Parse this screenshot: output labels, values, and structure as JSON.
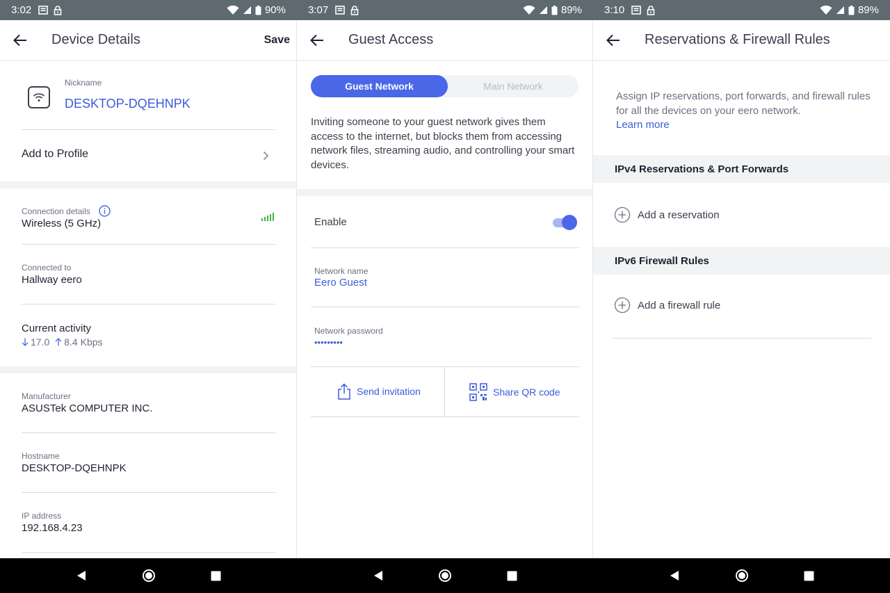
{
  "screens": [
    {
      "status": {
        "time": "3:02",
        "battery": "90%"
      },
      "header": {
        "title": "Device Details",
        "save_label": "Save"
      },
      "nickname": {
        "label": "Nickname",
        "value": "DESKTOP-DQEHNPK",
        "icon": "wifi-icon"
      },
      "add_to_profile": "Add to Profile",
      "connection": {
        "label": "Connection details",
        "value": "Wireless (5 GHz)",
        "signal_color": "#3fb53f"
      },
      "connected_to": {
        "label": "Connected to",
        "value": "Hallway eero"
      },
      "activity": {
        "label": "Current activity",
        "down": "17.0",
        "up": "8.4 Kbps"
      },
      "manufacturer": {
        "label": "Manufacturer",
        "value": "ASUSTek COMPUTER INC."
      },
      "hostname": {
        "label": "Hostname",
        "value": "DESKTOP-DQEHNPK"
      },
      "ip": {
        "label": "IP address",
        "value": "192.168.4.23"
      }
    },
    {
      "status": {
        "time": "3:07",
        "battery": "89%"
      },
      "header": {
        "title": "Guest Access"
      },
      "tabs": {
        "active": "Guest Network",
        "inactive": "Main Network"
      },
      "description": "Inviting someone to your guest network gives them access to the internet, but blocks them from accessing network files, streaming audio, and controlling your smart devices.",
      "enable": {
        "label": "Enable",
        "on": true
      },
      "network_name": {
        "label": "Network name",
        "value": "Eero Guest"
      },
      "network_password": {
        "label": "Network password",
        "value": "•••••••••"
      },
      "actions": {
        "send": "Send invitation",
        "share": "Share QR code"
      }
    },
    {
      "status": {
        "time": "3:10",
        "battery": "89%"
      },
      "header": {
        "title": "Reservations & Firewall Rules"
      },
      "intro": "Assign IP reservations, port forwards, and firewall rules for all the devices on your eero network.",
      "learn_more": "Learn more",
      "ipv4": {
        "title": "IPv4 Reservations & Port Forwards",
        "add": "Add a reservation"
      },
      "ipv6": {
        "title": "IPv6 Firewall Rules",
        "add": "Add a firewall rule"
      }
    }
  ],
  "colors": {
    "accent": "#4a67e8",
    "link": "#3a5bd9",
    "statusbar": "#5f6a70",
    "navbar": "#000000"
  }
}
